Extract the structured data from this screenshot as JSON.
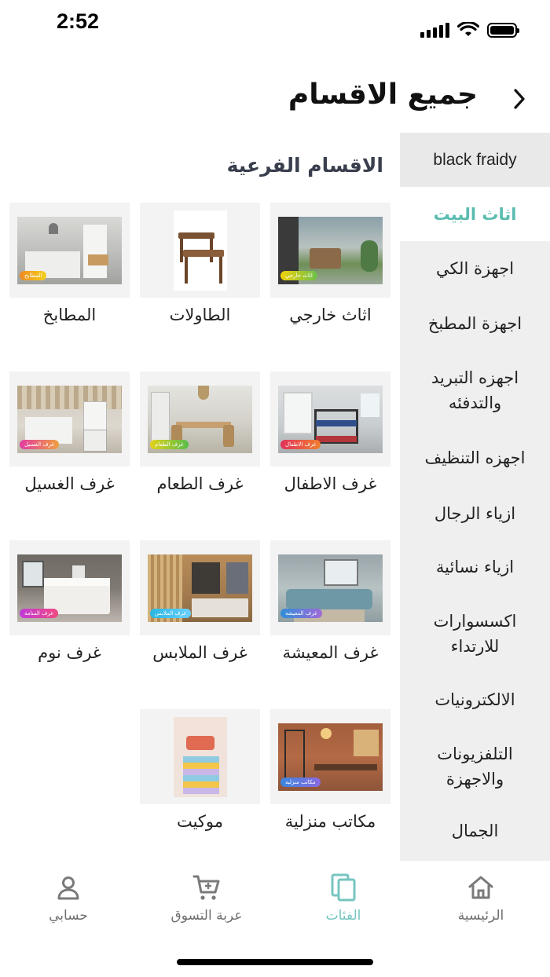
{
  "status_bar": {
    "time": "2:52"
  },
  "header": {
    "title": "جميع الاقسام",
    "back_icon": "chevron-right-icon"
  },
  "sidebar": {
    "items": [
      {
        "label": "black fraidy",
        "state": "normal"
      },
      {
        "label": "اثاث البيت",
        "state": "active"
      },
      {
        "label": "اجهزة الكي",
        "state": "normal"
      },
      {
        "label": "اجهزة المطبخ",
        "state": "normal"
      },
      {
        "label": "اجهزه التبريد والتدفئه",
        "state": "normal"
      },
      {
        "label": "اجهزه التنظيف",
        "state": "normal"
      },
      {
        "label": "ازياء الرجال",
        "state": "normal"
      },
      {
        "label": "ازياء نسائية",
        "state": "normal"
      },
      {
        "label": "اكسسوارات للارتداء",
        "state": "normal"
      },
      {
        "label": "الالكترونيات",
        "state": "normal"
      },
      {
        "label": "التلفزيونات والاجهزة",
        "state": "normal"
      },
      {
        "label": "الجمال",
        "state": "normal"
      }
    ]
  },
  "main": {
    "subcategories_title": "الاقسام الفرعية",
    "tiles": [
      {
        "label": "اثاث خارجي",
        "badge": "اثاث خارجي"
      },
      {
        "label": "الطاولات",
        "badge": ""
      },
      {
        "label": "المطابخ",
        "badge": "المطابخ"
      },
      {
        "label": "غرف الاطفال",
        "badge": "غرف الاطفال"
      },
      {
        "label": "غرف الطعام",
        "badge": "غرف الطعام"
      },
      {
        "label": "غرف الغسيل",
        "badge": "غرف الغسيل"
      },
      {
        "label": "غرف المعيشة",
        "badge": "غرف المعيشة"
      },
      {
        "label": "غرف الملابس",
        "badge": "غرف الملابس"
      },
      {
        "label": "غرف نوم",
        "badge": "غرف المنامة"
      },
      {
        "label": "مكاتب منزلية",
        "badge": "مكاتب منزلية"
      },
      {
        "label": "موكيت",
        "badge": ""
      }
    ]
  },
  "bottom_nav": {
    "items": [
      {
        "label": "الرئيسية",
        "icon": "home-icon"
      },
      {
        "label": "الفئات",
        "icon": "categories-icon",
        "active": true
      },
      {
        "label": "عربة التسوق",
        "icon": "cart-icon"
      },
      {
        "label": "حسابي",
        "icon": "user-icon"
      }
    ]
  },
  "colors": {
    "accent": "#5bbcb0",
    "nav_active": "#76c5c0",
    "sidebar_bg": "#efefef",
    "tile_bg": "#f3f3f3"
  }
}
